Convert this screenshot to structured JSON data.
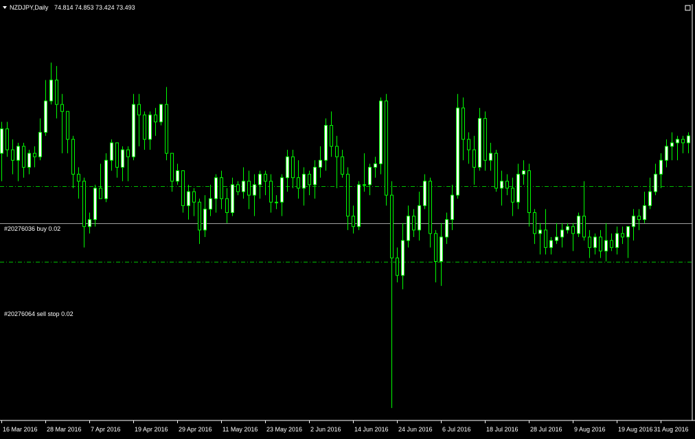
{
  "window": {
    "symbol_label": "NZDJPY,Daily",
    "ohlc_label": "74.814 74.853 73.424 73.493"
  },
  "order_lines": [
    {
      "label": "#20276036 buy 0.02",
      "price": 74.55
    },
    {
      "label": "#20276064 sell stop 0.02",
      "price": 72.4
    }
  ],
  "current_price": 73.493,
  "colors": {
    "background": "#000000",
    "bull_body": "#ffffff",
    "bear_body": "#000000",
    "wick": "#00ff00",
    "order_line": "#00c000",
    "price_line": "#a0a0a0",
    "text": "#ffffff"
  },
  "chart_data": {
    "type": "candlestick",
    "symbol": "NZDJPY",
    "timeframe": "Daily",
    "ylim": [
      68.0,
      79.5
    ],
    "x_tick_labels": [
      {
        "bar": 0,
        "label": "16 Mar 2016"
      },
      {
        "bar": 8,
        "label": "28 Mar 2016"
      },
      {
        "bar": 16,
        "label": "7 Apr 2016"
      },
      {
        "bar": 24,
        "label": "19 Apr 2016"
      },
      {
        "bar": 32,
        "label": "29 Apr 2016"
      },
      {
        "bar": 40,
        "label": "11 May 2016"
      },
      {
        "bar": 48,
        "label": "23 May 2016"
      },
      {
        "bar": 56,
        "label": "2 Jun 2016"
      },
      {
        "bar": 64,
        "label": "14 Jun 2016"
      },
      {
        "bar": 72,
        "label": "24 Jun 2016"
      },
      {
        "bar": 80,
        "label": "6 Jul 2016"
      },
      {
        "bar": 88,
        "label": "18 Jul 2016"
      },
      {
        "bar": 96,
        "label": "28 Jul 2016"
      },
      {
        "bar": 104,
        "label": "9 Aug 2016"
      },
      {
        "bar": 112,
        "label": "19 Aug 2016"
      },
      {
        "bar": 120,
        "label": "31 Aug 2016"
      }
    ],
    "candles": [
      [
        75.5,
        76.4,
        74.7,
        76.2
      ],
      [
        76.2,
        76.4,
        75.4,
        75.6
      ],
      [
        75.6,
        75.9,
        74.9,
        75.3
      ],
      [
        75.3,
        75.8,
        74.7,
        75.7
      ],
      [
        75.7,
        75.8,
        74.8,
        75.1
      ],
      [
        75.1,
        75.6,
        74.9,
        75.5
      ],
      [
        75.5,
        75.7,
        75.1,
        75.4
      ],
      [
        75.4,
        76.5,
        75.3,
        76.1
      ],
      [
        76.1,
        77.6,
        76.0,
        77.0
      ],
      [
        77.0,
        78.1,
        76.9,
        77.6
      ],
      [
        77.6,
        78.0,
        76.5,
        76.9
      ],
      [
        76.9,
        77.2,
        75.5,
        76.7
      ],
      [
        76.7,
        76.7,
        75.5,
        75.9
      ],
      [
        75.9,
        76.0,
        74.5,
        74.9
      ],
      [
        74.9,
        75.1,
        74.2,
        74.7
      ],
      [
        74.7,
        74.8,
        72.8,
        73.4
      ],
      [
        73.4,
        73.8,
        73.2,
        73.6
      ],
      [
        73.6,
        74.6,
        73.4,
        74.5
      ],
      [
        74.5,
        75.2,
        74.2,
        74.2
      ],
      [
        74.2,
        75.5,
        74.1,
        75.3
      ],
      [
        75.3,
        75.9,
        75.0,
        75.8
      ],
      [
        75.8,
        75.8,
        74.8,
        75.1
      ],
      [
        75.1,
        75.7,
        74.7,
        75.6
      ],
      [
        75.6,
        75.7,
        74.7,
        75.4
      ],
      [
        75.4,
        77.2,
        75.3,
        76.9
      ],
      [
        76.9,
        77.2,
        75.7,
        76.6
      ],
      [
        76.6,
        76.7,
        75.6,
        75.9
      ],
      [
        75.9,
        76.7,
        75.6,
        76.6
      ],
      [
        76.6,
        76.8,
        76.0,
        76.4
      ],
      [
        76.4,
        76.9,
        76.3,
        76.9
      ],
      [
        76.9,
        77.4,
        75.3,
        75.5
      ],
      [
        75.5,
        75.5,
        74.4,
        74.7
      ],
      [
        74.7,
        75.2,
        74.6,
        75.0
      ],
      [
        75.0,
        75.0,
        73.8,
        74.0
      ],
      [
        74.0,
        74.6,
        73.6,
        74.4
      ],
      [
        74.4,
        74.5,
        73.7,
        74.1
      ],
      [
        74.1,
        74.2,
        72.9,
        73.3
      ],
      [
        73.3,
        74.3,
        73.1,
        73.9
      ],
      [
        73.9,
        74.6,
        73.7,
        74.2
      ],
      [
        74.2,
        74.9,
        73.8,
        74.8
      ],
      [
        74.8,
        75.0,
        73.9,
        74.2
      ],
      [
        74.2,
        74.5,
        73.5,
        73.8
      ],
      [
        73.8,
        74.8,
        73.7,
        74.6
      ],
      [
        74.6,
        74.7,
        74.3,
        74.4
      ],
      [
        74.4,
        75.1,
        74.2,
        74.7
      ],
      [
        74.7,
        75.0,
        73.9,
        74.3
      ],
      [
        74.3,
        74.9,
        73.7,
        74.6
      ],
      [
        74.6,
        75.0,
        74.2,
        74.9
      ],
      [
        74.9,
        75.0,
        74.3,
        74.7
      ],
      [
        74.7,
        74.9,
        73.8,
        74.1
      ],
      [
        74.1,
        74.3,
        73.9,
        74.1
      ],
      [
        74.1,
        74.9,
        73.7,
        74.8
      ],
      [
        74.8,
        75.6,
        74.4,
        75.4
      ],
      [
        75.4,
        75.6,
        74.5,
        74.8
      ],
      [
        74.8,
        75.3,
        74.2,
        74.5
      ],
      [
        74.5,
        75.1,
        74.0,
        74.9
      ],
      [
        74.9,
        75.0,
        74.3,
        74.6
      ],
      [
        74.6,
        75.3,
        74.2,
        75.1
      ],
      [
        75.1,
        75.7,
        74.8,
        75.3
      ],
      [
        75.3,
        76.5,
        75.0,
        76.3
      ],
      [
        76.3,
        76.7,
        75.4,
        75.7
      ],
      [
        75.7,
        76.0,
        74.5,
        75.4
      ],
      [
        75.4,
        75.6,
        74.8,
        74.9
      ],
      [
        74.9,
        75.1,
        73.3,
        73.7
      ],
      [
        73.7,
        74.0,
        73.2,
        73.4
      ],
      [
        73.4,
        74.7,
        73.3,
        74.6
      ],
      [
        74.6,
        75.5,
        74.4,
        74.6
      ],
      [
        74.6,
        75.2,
        74.3,
        75.1
      ],
      [
        75.1,
        75.4,
        74.8,
        75.2
      ],
      [
        75.2,
        77.1,
        74.9,
        77.0
      ],
      [
        77.0,
        77.2,
        74.0,
        74.3
      ],
      [
        74.3,
        74.7,
        68.2,
        72.5
      ],
      [
        72.5,
        72.8,
        71.8,
        72.0
      ],
      [
        72.0,
        73.5,
        71.6,
        73.0
      ],
      [
        73.0,
        74.0,
        72.8,
        73.7
      ],
      [
        73.7,
        73.9,
        73.1,
        73.3
      ],
      [
        73.3,
        74.4,
        73.0,
        74.0
      ],
      [
        74.0,
        74.9,
        73.9,
        74.7
      ],
      [
        74.7,
        74.8,
        72.8,
        73.2
      ],
      [
        73.2,
        73.3,
        71.8,
        72.4
      ],
      [
        72.4,
        73.5,
        71.7,
        73.1
      ],
      [
        73.1,
        73.8,
        72.9,
        73.6
      ],
      [
        73.6,
        74.6,
        73.3,
        74.3
      ],
      [
        74.3,
        77.2,
        74.2,
        76.8
      ],
      [
        76.8,
        77.1,
        75.3,
        75.9
      ],
      [
        75.9,
        76.1,
        75.2,
        75.6
      ],
      [
        75.6,
        76.0,
        74.6,
        75.1
      ],
      [
        75.1,
        76.8,
        75.0,
        76.5
      ],
      [
        76.5,
        76.7,
        75.0,
        75.3
      ],
      [
        75.3,
        75.8,
        75.0,
        75.5
      ],
      [
        75.5,
        75.6,
        74.4,
        74.5
      ],
      [
        74.5,
        75.0,
        74.0,
        74.7
      ],
      [
        74.7,
        74.9,
        74.3,
        74.5
      ],
      [
        74.5,
        74.8,
        73.7,
        74.1
      ],
      [
        74.1,
        75.2,
        73.9,
        74.9
      ],
      [
        74.9,
        75.3,
        74.6,
        75.0
      ],
      [
        75.0,
        75.2,
        73.4,
        73.8
      ],
      [
        73.8,
        73.9,
        72.9,
        73.2
      ],
      [
        73.2,
        73.5,
        72.6,
        73.3
      ],
      [
        73.3,
        73.9,
        72.6,
        72.8
      ],
      [
        72.8,
        73.1,
        72.6,
        73.0
      ],
      [
        73.0,
        73.5,
        72.9,
        73.1
      ],
      [
        73.1,
        73.5,
        72.8,
        73.3
      ],
      [
        73.3,
        73.5,
        73.2,
        73.4
      ],
      [
        73.4,
        73.5,
        72.7,
        73.2
      ],
      [
        73.2,
        73.8,
        73.1,
        73.7
      ],
      [
        73.7,
        74.7,
        73.0,
        73.1
      ],
      [
        73.1,
        73.3,
        72.5,
        72.8
      ],
      [
        72.8,
        73.2,
        72.6,
        73.1
      ],
      [
        73.1,
        73.3,
        72.5,
        72.7
      ],
      [
        72.7,
        73.5,
        72.4,
        73.0
      ],
      [
        73.0,
        73.2,
        72.7,
        72.8
      ],
      [
        72.8,
        73.4,
        72.6,
        73.2
      ],
      [
        73.2,
        73.4,
        72.9,
        73.1
      ],
      [
        73.1,
        73.3,
        72.5,
        73.4
      ],
      [
        73.4,
        73.9,
        73.0,
        73.7
      ],
      [
        73.7,
        73.9,
        73.3,
        73.6
      ],
      [
        73.6,
        74.4,
        73.5,
        74.0
      ],
      [
        74.0,
        74.8,
        73.9,
        74.4
      ],
      [
        74.4,
        75.2,
        74.3,
        74.9
      ],
      [
        74.9,
        75.5,
        74.5,
        75.3
      ],
      [
        75.3,
        75.9,
        75.1,
        75.7
      ],
      [
        75.7,
        76.1,
        75.3,
        75.8
      ],
      [
        75.8,
        76.0,
        75.3,
        75.9
      ],
      [
        75.9,
        76.0,
        75.5,
        75.8
      ],
      [
        75.8,
        76.1,
        75.5,
        76.0
      ],
      [
        74.814,
        74.853,
        73.424,
        73.493
      ]
    ]
  }
}
